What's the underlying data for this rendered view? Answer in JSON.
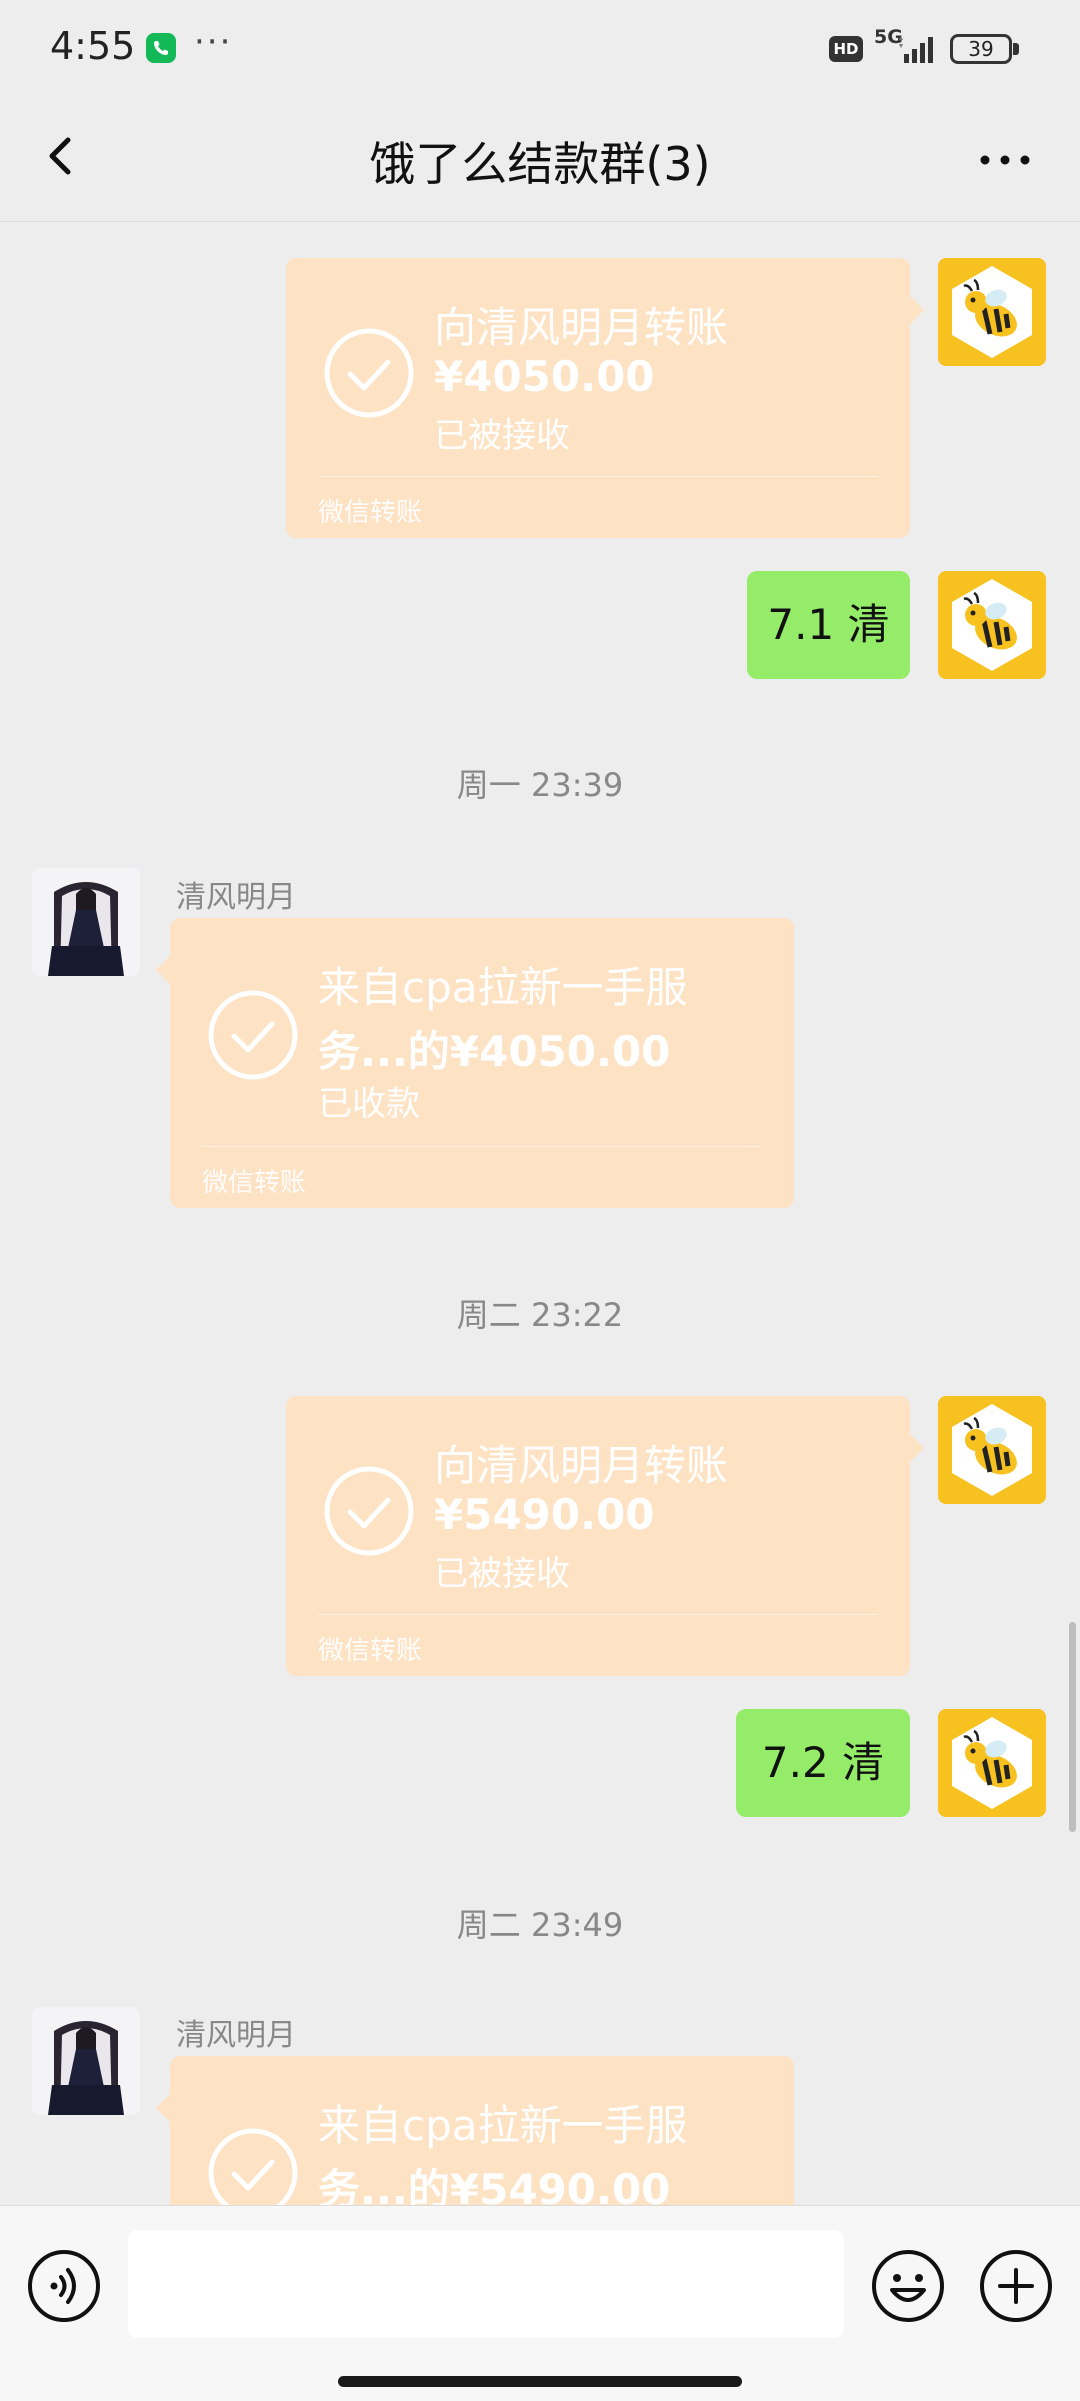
{
  "status_bar": {
    "time": "4:55",
    "dots": "···",
    "hd": "HD",
    "network": "5G",
    "battery": "39"
  },
  "nav": {
    "title": "饿了么结款群(3)"
  },
  "colors": {
    "transfer_card": "#fde2c4",
    "my_bubble": "#95ec69",
    "call_icon": "#13b956",
    "bee_avatar_bg": "#f7c21f",
    "background": "#ededed"
  },
  "messages": [
    {
      "type": "transfer",
      "side": "right",
      "title": "向清风明月转账",
      "amount": "¥4050.00",
      "status": "已被接收",
      "footer": "微信转账"
    },
    {
      "type": "text",
      "side": "right",
      "text": "7.1 清"
    },
    {
      "type": "timestamp",
      "text": "周一 23:39"
    },
    {
      "type": "transfer",
      "side": "left",
      "sender": "清风明月",
      "title": "来自cpa拉新一手服",
      "amount": "务...的¥4050.00",
      "status": "已收款",
      "footer": "微信转账"
    },
    {
      "type": "timestamp",
      "text": "周二 23:22"
    },
    {
      "type": "transfer",
      "side": "right",
      "title": "向清风明月转账",
      "amount": "¥5490.00",
      "status": "已被接收",
      "footer": "微信转账"
    },
    {
      "type": "text",
      "side": "right",
      "text": "7.2 清"
    },
    {
      "type": "timestamp",
      "text": "周二 23:49"
    },
    {
      "type": "transfer",
      "side": "left",
      "sender": "清风明月",
      "title": "来自cpa拉新一手服",
      "amount": "务...的¥5490.00"
    }
  ],
  "input_bar": {
    "placeholder": "",
    "voice_icon": "voice-icon",
    "emoji_icon": "emoji-icon",
    "plus_icon": "plus-icon"
  }
}
